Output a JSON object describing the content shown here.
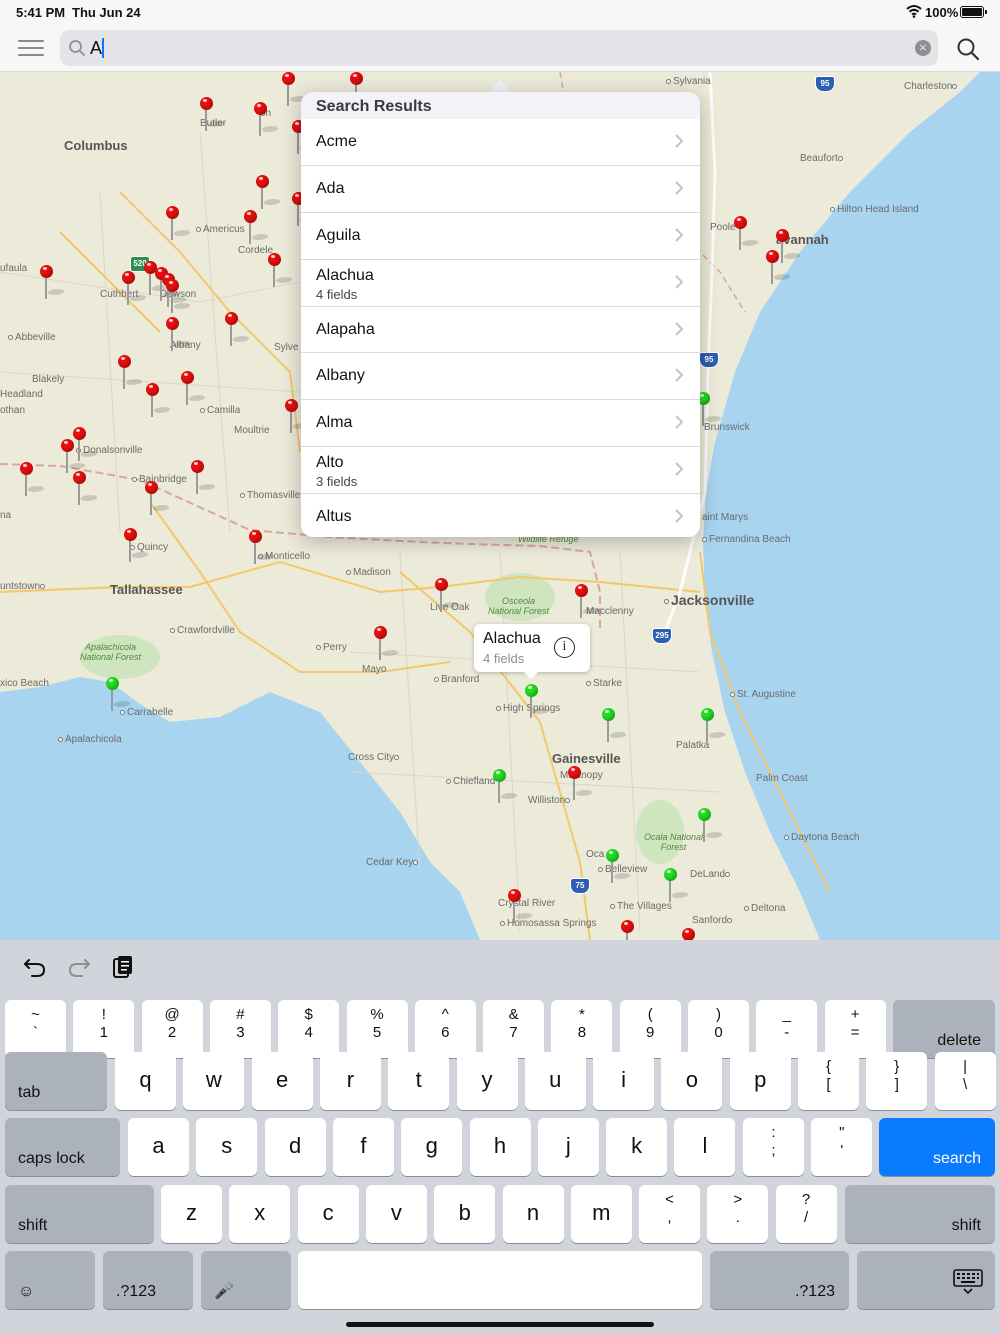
{
  "status_bar": {
    "time": "5:41 PM",
    "date": "Thu Jun 24",
    "battery": "100%"
  },
  "search": {
    "value": "A",
    "clear_label": "⨯"
  },
  "results": {
    "header": "Search Results",
    "items": [
      {
        "name": "Acme",
        "sub": ""
      },
      {
        "name": "Ada",
        "sub": ""
      },
      {
        "name": "Aguila",
        "sub": ""
      },
      {
        "name": "Alachua",
        "sub": "4 fields"
      },
      {
        "name": "Alapaha",
        "sub": ""
      },
      {
        "name": "Albany",
        "sub": ""
      },
      {
        "name": "Alma",
        "sub": ""
      },
      {
        "name": "Alto",
        "sub": "3 fields"
      },
      {
        "name": "Altus",
        "sub": ""
      }
    ]
  },
  "callout": {
    "title": "Alachua",
    "sub": "4 fields",
    "info": "i"
  },
  "map": {
    "cities": {
      "columbus": "Columbus",
      "butler": "Butler",
      "americus": "Americus",
      "cordele": "Cordele",
      "cuthbert": "Cuthbert",
      "dawson": "Dawson",
      "eufaula": "ufaula",
      "abbeville": "Abbeville",
      "albany": "Albany",
      "sylvester": "Sylve",
      "blakely": "Blakely",
      "headland": "Headland",
      "dothan": "othan",
      "camilla": "Camilla",
      "moultrie": "Moultrie",
      "donalsonville": "Donalsonville",
      "bainbridge": "Bainbridge",
      "thomasville": "Thomasville",
      "quincy": "Quincy",
      "tallahassee": "Tallahassee",
      "monticello": "Monticello",
      "madison": "Madison",
      "perry": "Perry",
      "mayo": "Mayo",
      "liveoak": "Live Oak",
      "crawfordville": "Crawfordville",
      "carrabelle": "Carrabelle",
      "apalachicola": "Apalachicola",
      "mexico_beach": "xico Beach",
      "branford": "Branford",
      "highsprings": "High Springs",
      "gainesville": "Gainesville",
      "micanopy": "Micanopy",
      "chiefland": "Chiefland",
      "williston": "Williston",
      "crosscity": "Cross City",
      "cedarkey": "Cedar Key",
      "ocala": "Oca",
      "belleview": "Belleview",
      "crystalriver": "Crystal River",
      "homosassa": "Homosassa Springs",
      "thevillages": "The Villages",
      "sanford": "Sanford",
      "deland": "DeLand",
      "deltona": "Deltona",
      "daytona": "Daytona Beach",
      "palmcoast": "Palm Coast",
      "staugustine": "St. Augustine",
      "palatka": "Palatka",
      "starke": "Starke",
      "macclenny": "Macclenny",
      "jacksonville": "Jacksonville",
      "fernandina": "Fernandina Beach",
      "stmarys": "aint Marys",
      "brunswick": "Brunswick",
      "savannah": "avannah",
      "pooler": "Poole",
      "hiltonhead": "Hilton Head Island",
      "beaufort": "Beaufort",
      "charleston": "Charleston",
      "sylvania": "Sylvania",
      "uniontown": "untstown",
      "ona": "na",
      "meigs": "on"
    },
    "forests": {
      "osceola": "Osceola\nNational Forest",
      "apalachicola_nf": "Apalachicola\nNational Forest",
      "ocala_nf": "Ocala National\nForest",
      "wildlife": "Wildlife Refuge"
    },
    "shields": {
      "i95_top": "95",
      "i95_mid": "95",
      "i295": "295",
      "i75": "75",
      "us520": "520"
    },
    "colors": {
      "water": "#a8d4f0",
      "land": "#ecead9",
      "park": "#cfe5c0",
      "red_pin": "#e80f0f",
      "green_pin": "#22dd22"
    }
  },
  "keyboard": {
    "number_row": [
      {
        "top": "~",
        "bot": "`"
      },
      {
        "top": "!",
        "bot": "1"
      },
      {
        "top": "@",
        "bot": "2"
      },
      {
        "top": "#",
        "bot": "3"
      },
      {
        "top": "$",
        "bot": "4"
      },
      {
        "top": "%",
        "bot": "5"
      },
      {
        "top": "^",
        "bot": "6"
      },
      {
        "top": "&",
        "bot": "7"
      },
      {
        "top": "*",
        "bot": "8"
      },
      {
        "top": "(",
        "bot": "9"
      },
      {
        "top": ")",
        "bot": "0"
      },
      {
        "top": "_",
        "bot": "-"
      },
      {
        "top": "+",
        "bot": "="
      }
    ],
    "delete": "delete",
    "tab": "tab",
    "row_q": [
      "q",
      "w",
      "e",
      "r",
      "t",
      "y",
      "u",
      "i",
      "o",
      "p"
    ],
    "row_q_sym": [
      {
        "top": "{",
        "bot": "["
      },
      {
        "top": "}",
        "bot": "]"
      },
      {
        "top": "|",
        "bot": "\\"
      }
    ],
    "caps": "caps lock",
    "row_a": [
      "a",
      "s",
      "d",
      "f",
      "g",
      "h",
      "j",
      "k",
      "l"
    ],
    "row_a_sym": [
      {
        "top": ":",
        "bot": ";"
      },
      {
        "top": "\"",
        "bot": "'"
      }
    ],
    "search": "search",
    "shift": "shift",
    "row_z": [
      "z",
      "x",
      "c",
      "v",
      "b",
      "n",
      "m"
    ],
    "row_z_sym": [
      {
        "top": "<",
        "bot": ","
      },
      {
        "top": ">",
        "bot": "."
      },
      {
        "top": "?",
        "bot": "/"
      }
    ],
    "num_toggle": ".?123",
    "emoji": "☺",
    "mic": "🎤"
  }
}
